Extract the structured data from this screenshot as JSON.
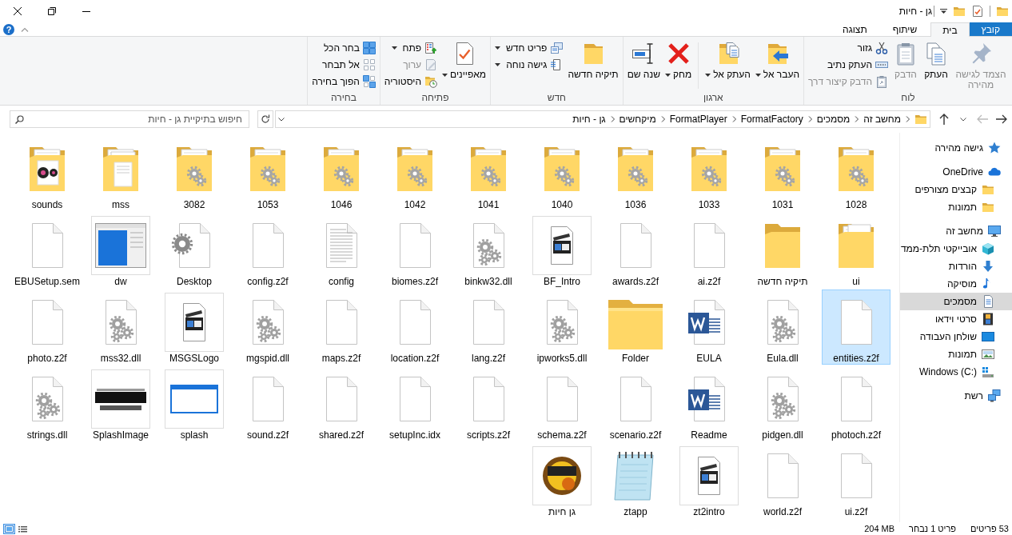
{
  "window": {
    "title": "גן - חיות"
  },
  "tabs": [
    {
      "label": "קובץ",
      "kind": "file-menu",
      "selected": false
    },
    {
      "label": "בית",
      "kind": "tab",
      "selected": true
    },
    {
      "label": "שיתוף",
      "kind": "tab",
      "selected": false
    },
    {
      "label": "תצוגה",
      "kind": "tab",
      "selected": false
    }
  ],
  "help_button": "?",
  "ribbon": {
    "groups": [
      {
        "label": "לוח",
        "items": [
          {
            "kind": "pin",
            "label": "הצמד לגישה מהירה",
            "disabled": true,
            "dropdown": false
          },
          {
            "kind": "copy",
            "label": "העתק",
            "disabled": false,
            "dropdown": false
          },
          {
            "kind": "paste",
            "label": "הדבק",
            "disabled": true,
            "dropdown": false
          },
          {
            "kind": "stack",
            "buttons": [
              {
                "kind": "cut",
                "label": "גזור",
                "disabled": false,
                "dropdown": false
              },
              {
                "kind": "copy-path",
                "label": "העתק נתיב",
                "disabled": false,
                "dropdown": false
              },
              {
                "kind": "paste-shortcut",
                "label": "הדבק קיצור דרך",
                "disabled": true,
                "dropdown": false
              }
            ]
          }
        ]
      },
      {
        "label": "ארגון",
        "items": [
          {
            "kind": "move",
            "label": "העבר אל",
            "disabled": false,
            "dropdown": true
          },
          {
            "kind": "copy-to",
            "label": "העתק אל",
            "disabled": false,
            "dropdown": true
          },
          {
            "kind": "separator"
          },
          {
            "kind": "delete",
            "label": "מחק",
            "disabled": false,
            "dropdown": true
          },
          {
            "kind": "rename",
            "label": "שנה שם",
            "disabled": false,
            "dropdown": false
          }
        ]
      },
      {
        "label": "חדש",
        "items": [
          {
            "kind": "new-folder",
            "label": "תיקיה חדשה",
            "disabled": false,
            "dropdown": false
          },
          {
            "kind": "stack",
            "buttons": [
              {
                "kind": "new-item",
                "label": "פריט חדש",
                "disabled": false,
                "dropdown": true
              },
              {
                "kind": "easy-access",
                "label": "גישה נוחה",
                "disabled": false,
                "dropdown": true
              }
            ]
          }
        ]
      },
      {
        "label": "פתיחה",
        "items": [
          {
            "kind": "properties",
            "label": "מאפיינים",
            "disabled": false,
            "dropdown": true
          },
          {
            "kind": "stack",
            "buttons": [
              {
                "kind": "open",
                "label": "פתח",
                "disabled": false,
                "dropdown": true
              },
              {
                "kind": "edit",
                "label": "ערוך",
                "disabled": true,
                "dropdown": false
              },
              {
                "kind": "history",
                "label": "היסטוריה",
                "disabled": false,
                "dropdown": false
              }
            ]
          }
        ]
      },
      {
        "label": "בחירה",
        "items": [
          {
            "kind": "stack",
            "buttons": [
              {
                "kind": "select-all",
                "label": "בחר הכל",
                "disabled": false,
                "dropdown": false
              },
              {
                "kind": "select-none",
                "label": "אל תבחר",
                "disabled": false,
                "dropdown": false
              },
              {
                "kind": "invert",
                "label": "הפוך בחירה",
                "disabled": false,
                "dropdown": false
              }
            ]
          }
        ]
      }
    ]
  },
  "navigation": {
    "back_disabled": false,
    "forward_disabled": true
  },
  "address_bar": {
    "crumbs": [
      "מחשב זה",
      "מסמכים",
      "FormatFactory",
      "FormatPlayer",
      "מיקחשים",
      "גן - חיות"
    ]
  },
  "search": {
    "placeholder": "חיפוש בתיקיית גן - חיות"
  },
  "sidebar": {
    "items": [
      {
        "label": "גישה מהירה",
        "kind": "quick-access",
        "selected": false
      },
      {
        "label": "OneDrive",
        "kind": "cloud",
        "selected": false,
        "children": [
          {
            "label": "קבצים מצורפים",
            "kind": "folder",
            "selected": false
          },
          {
            "label": "תמונות",
            "kind": "folder",
            "selected": false
          }
        ]
      },
      {
        "label": "מחשב זה",
        "kind": "computer",
        "selected": false,
        "children": [
          {
            "label": "אובייקטי תלת-ממד",
            "kind": "objects-3d",
            "selected": false
          },
          {
            "label": "הורדות",
            "kind": "downloads",
            "selected": false
          },
          {
            "label": "מוסיקה",
            "kind": "music",
            "selected": false
          },
          {
            "label": "מסמכים",
            "kind": "documents",
            "selected": true
          },
          {
            "label": "סרטי וידאו",
            "kind": "videos",
            "selected": false
          },
          {
            "label": "שולחן העבודה",
            "kind": "desktop",
            "selected": false
          },
          {
            "label": "תמונות",
            "kind": "pictures",
            "selected": false
          },
          {
            "label": "Windows (C:)",
            "kind": "drive",
            "selected": false
          }
        ]
      },
      {
        "label": "רשת",
        "kind": "network",
        "selected": false
      }
    ]
  },
  "files": [
    {
      "name": "1028",
      "kind": "folder-gear",
      "selected": false
    },
    {
      "name": "1031",
      "kind": "folder-gear",
      "selected": false
    },
    {
      "name": "1033",
      "kind": "folder-gear",
      "selected": false
    },
    {
      "name": "1036",
      "kind": "folder-gear",
      "selected": false
    },
    {
      "name": "1040",
      "kind": "folder-gear",
      "selected": false
    },
    {
      "name": "1041",
      "kind": "folder-gear",
      "selected": false
    },
    {
      "name": "1042",
      "kind": "folder-gear",
      "selected": false
    },
    {
      "name": "1046",
      "kind": "folder-gear",
      "selected": false
    },
    {
      "name": "1053",
      "kind": "folder-gear",
      "selected": false
    },
    {
      "name": "3082",
      "kind": "folder-gear",
      "selected": false
    },
    {
      "name": "mss",
      "kind": "folder-docs",
      "selected": false
    },
    {
      "name": "sounds",
      "kind": "folder-media",
      "selected": false
    },
    {
      "name": "ui",
      "kind": "folder-open",
      "selected": false
    },
    {
      "name": "תיקיה חדשה",
      "kind": "folder",
      "selected": false
    },
    {
      "name": "ai.z2f",
      "kind": "file",
      "selected": false
    },
    {
      "name": "awards.z2f",
      "kind": "file",
      "selected": false
    },
    {
      "name": "BF_Intro",
      "kind": "video",
      "selected": false
    },
    {
      "name": "binkw32.dll",
      "kind": "dll",
      "selected": false
    },
    {
      "name": "biomes.z2f",
      "kind": "file",
      "selected": false
    },
    {
      "name": "config",
      "kind": "text",
      "selected": false
    },
    {
      "name": "config.z2f",
      "kind": "file",
      "selected": false
    },
    {
      "name": "Desktop",
      "kind": "settings",
      "selected": false
    },
    {
      "name": "dw",
      "kind": "window",
      "selected": false
    },
    {
      "name": "EBUSetup.sem",
      "kind": "file",
      "selected": false
    },
    {
      "name": "entities.z2f",
      "kind": "file",
      "selected": true
    },
    {
      "name": "Eula.dll",
      "kind": "dll",
      "selected": false
    },
    {
      "name": "EULA",
      "kind": "word",
      "selected": false
    },
    {
      "name": "Folder",
      "kind": "folder-large",
      "selected": false
    },
    {
      "name": "ipworks5.dll",
      "kind": "dll",
      "selected": false
    },
    {
      "name": "lang.z2f",
      "kind": "file",
      "selected": false
    },
    {
      "name": "location.z2f",
      "kind": "file",
      "selected": false
    },
    {
      "name": "maps.z2f",
      "kind": "file",
      "selected": false
    },
    {
      "name": "mgspid.dll",
      "kind": "dll",
      "selected": false
    },
    {
      "name": "MSGSLogo",
      "kind": "video",
      "selected": false
    },
    {
      "name": "mss32.dll",
      "kind": "dll",
      "selected": false
    },
    {
      "name": "photo.z2f",
      "kind": "file",
      "selected": false
    },
    {
      "name": "photoch.z2f",
      "kind": "file",
      "selected": false
    },
    {
      "name": "pidgen.dll",
      "kind": "dll",
      "selected": false
    },
    {
      "name": "Readme",
      "kind": "word",
      "selected": false
    },
    {
      "name": "scenario.z2f",
      "kind": "file",
      "selected": false
    },
    {
      "name": "schema.z2f",
      "kind": "file",
      "selected": false
    },
    {
      "name": "scripts.z2f",
      "kind": "file",
      "selected": false
    },
    {
      "name": "setupInc.idx",
      "kind": "file",
      "selected": false
    },
    {
      "name": "shared.z2f",
      "kind": "file",
      "selected": false
    },
    {
      "name": "sound.z2f",
      "kind": "file",
      "selected": false
    },
    {
      "name": "splash",
      "kind": "splash",
      "selected": false
    },
    {
      "name": "SplashImage",
      "kind": "image",
      "selected": false
    },
    {
      "name": "strings.dll",
      "kind": "dll",
      "selected": false
    },
    {
      "name": "ui.z2f",
      "kind": "file",
      "selected": false
    },
    {
      "name": "world.z2f",
      "kind": "file",
      "selected": false
    },
    {
      "name": "zt2intro",
      "kind": "video",
      "selected": false
    },
    {
      "name": "ztapp",
      "kind": "notepad",
      "selected": false
    },
    {
      "name": "גן חיות",
      "kind": "game",
      "selected": false
    }
  ],
  "status_bar": {
    "item_count": "53 פריטים",
    "selection": "פריט 1 נבחר",
    "size": "204 MB",
    "views": [
      {
        "kind": "details",
        "selected": false
      },
      {
        "kind": "large-icons",
        "selected": true
      }
    ]
  }
}
